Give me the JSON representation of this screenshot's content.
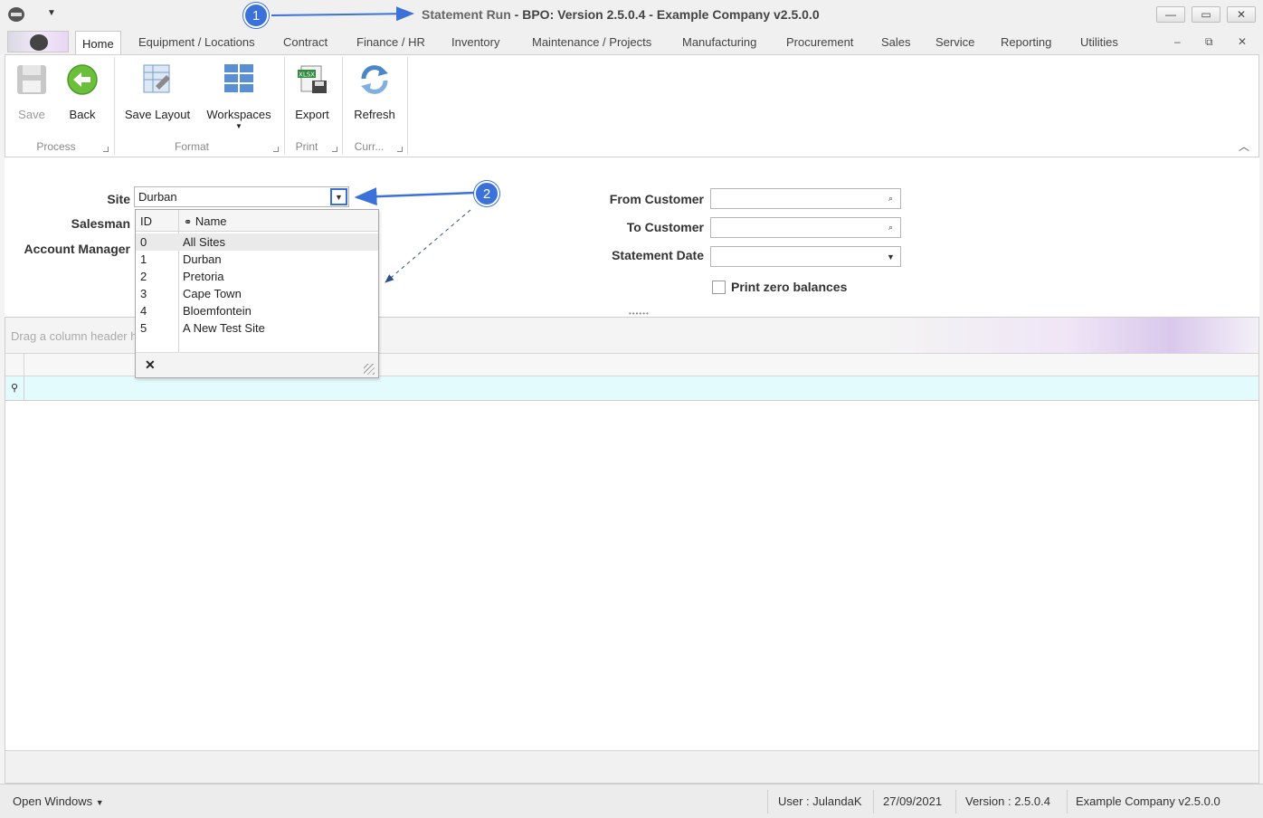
{
  "window": {
    "title_prefix": "Statement Run",
    "title_rest": " - BPO: Version 2.5.0.4 - Example Company v2.5.0.0",
    "minimize": "—",
    "maximize": "▭",
    "close": "✕"
  },
  "tabs": [
    {
      "label": "Home",
      "active": true
    },
    {
      "label": "Equipment / Locations"
    },
    {
      "label": "Contract"
    },
    {
      "label": "Finance / HR"
    },
    {
      "label": "Inventory"
    },
    {
      "label": "Maintenance / Projects"
    },
    {
      "label": "Manufacturing"
    },
    {
      "label": "Procurement"
    },
    {
      "label": "Sales"
    },
    {
      "label": "Service"
    },
    {
      "label": "Reporting"
    },
    {
      "label": "Utilities"
    }
  ],
  "mdi": {
    "minimize": "–",
    "restore": "⧉",
    "close": "✕"
  },
  "ribbon": {
    "save": "Save",
    "back": "Back",
    "save_layout": "Save Layout",
    "workspaces": "Workspaces",
    "export": "Export",
    "refresh": "Refresh",
    "groups": {
      "process": "Process",
      "format": "Format",
      "print": "Print",
      "curr": "Curr..."
    }
  },
  "filters": {
    "site_label": "Site",
    "site_value": "Durban",
    "salesman_label": "Salesman",
    "account_manager_label": "Account Manager",
    "from_customer_label": "From Customer",
    "to_customer_label": "To Customer",
    "statement_date_label": "Statement Date",
    "print_zero_label": "Print zero balances"
  },
  "site_dropdown": {
    "col_id": "ID",
    "col_name": "Name",
    "rows": [
      {
        "id": "0",
        "name": "All Sites"
      },
      {
        "id": "1",
        "name": "Durban"
      },
      {
        "id": "2",
        "name": "Pretoria"
      },
      {
        "id": "3",
        "name": "Cape Town"
      },
      {
        "id": "4",
        "name": "Bloemfontein"
      },
      {
        "id": "5",
        "name": "A New Test Site"
      }
    ],
    "close": "✕"
  },
  "grid": {
    "group_hint": "Drag a column header here to group by that column"
  },
  "status": {
    "open_windows": "Open Windows",
    "user": "User : JulandaK",
    "date": "27/09/2021",
    "version": "Version : 2.5.0.4",
    "company": "Example Company v2.5.0.0"
  },
  "annotations": {
    "badge1": "1",
    "badge2": "2"
  },
  "colors": {
    "accent": "#3b72d9",
    "filter_row": "#e4fbfd"
  }
}
